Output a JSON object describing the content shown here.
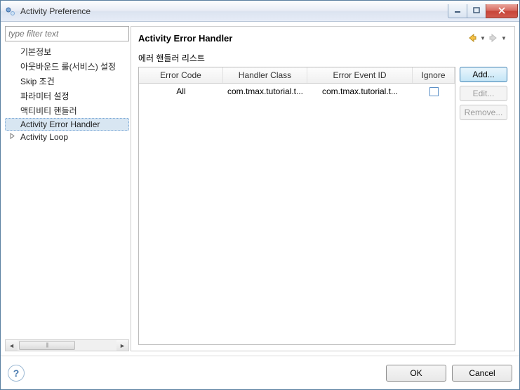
{
  "window": {
    "title": "Activity Preference"
  },
  "sidebar": {
    "filter_placeholder": "type filter text",
    "items": [
      {
        "label": "기본정보"
      },
      {
        "label": "아웃바운드 룰(서비스) 설정"
      },
      {
        "label": "Skip 조건"
      },
      {
        "label": "파라미터 설정"
      },
      {
        "label": "액티비티 핸들러"
      },
      {
        "label": "Activity Error Handler"
      },
      {
        "label": "Activity Loop"
      }
    ]
  },
  "content": {
    "title": "Activity Error Handler",
    "subtitle": "에러 핸들러 리스트",
    "columns": {
      "code": "Error Code",
      "class": "Handler Class",
      "event": "Error Event ID",
      "ignore": "Ignore"
    },
    "rows": [
      {
        "code": "All",
        "class": "com.tmax.tutorial.t...",
        "event": "com.tmax.tutorial.t...",
        "ignore": false
      }
    ],
    "buttons": {
      "add": "Add...",
      "edit": "Edit...",
      "remove": "Remove..."
    }
  },
  "footer": {
    "help": "?",
    "ok": "OK",
    "cancel": "Cancel"
  }
}
